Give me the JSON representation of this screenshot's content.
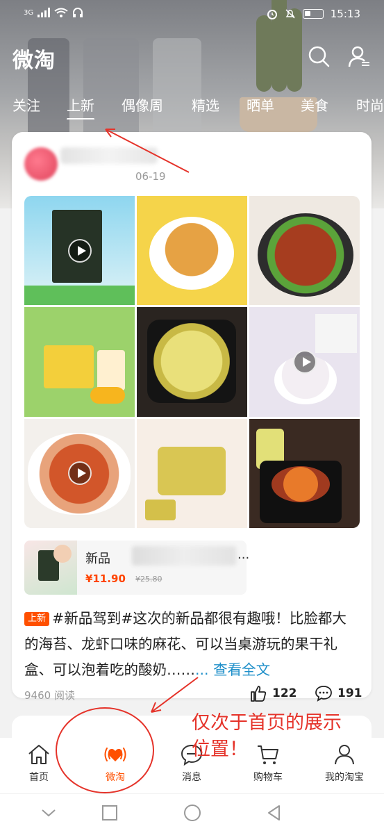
{
  "status_bar": {
    "network": "3G",
    "time": "15:13"
  },
  "header": {
    "title": "微淘",
    "search_icon": "search-icon",
    "profile_icon": "user-icon"
  },
  "tabs": [
    {
      "label": "关注",
      "active": false
    },
    {
      "label": "上新",
      "active": true
    },
    {
      "label": "偶像周",
      "active": false
    },
    {
      "label": "精选",
      "active": false
    },
    {
      "label": "晒单",
      "active": false
    },
    {
      "label": "美食",
      "active": false
    },
    {
      "label": "时尚",
      "active": false
    }
  ],
  "post": {
    "date": "06-19",
    "product": {
      "name_prefix": "新品",
      "ellipsis": "...",
      "price": "¥11.90",
      "original_price": "¥25.80"
    },
    "tag": "上新",
    "text": "#新品驾到#这次的新品都很有趣哦！比脸都大的海苔、龙虾口味的麻花、可以当桌游玩的果干礼盒、可以泡着吃的酸奶……",
    "more_link": "... 查看全文",
    "read_count": "9460 阅读",
    "likes": "122",
    "comments": "191"
  },
  "annotation": {
    "text_line1": "仅次于首页的展示",
    "text_line2": "位置！",
    "color": "#e5332a"
  },
  "bottom_nav": [
    {
      "label": "首页",
      "icon": "home-icon"
    },
    {
      "label": "微淘",
      "icon": "weitao-heart-icon",
      "active": true
    },
    {
      "label": "消息",
      "icon": "message-icon"
    },
    {
      "label": "购物车",
      "icon": "cart-icon"
    },
    {
      "label": "我的淘宝",
      "icon": "person-icon"
    }
  ],
  "accent_color": "#ff5000"
}
